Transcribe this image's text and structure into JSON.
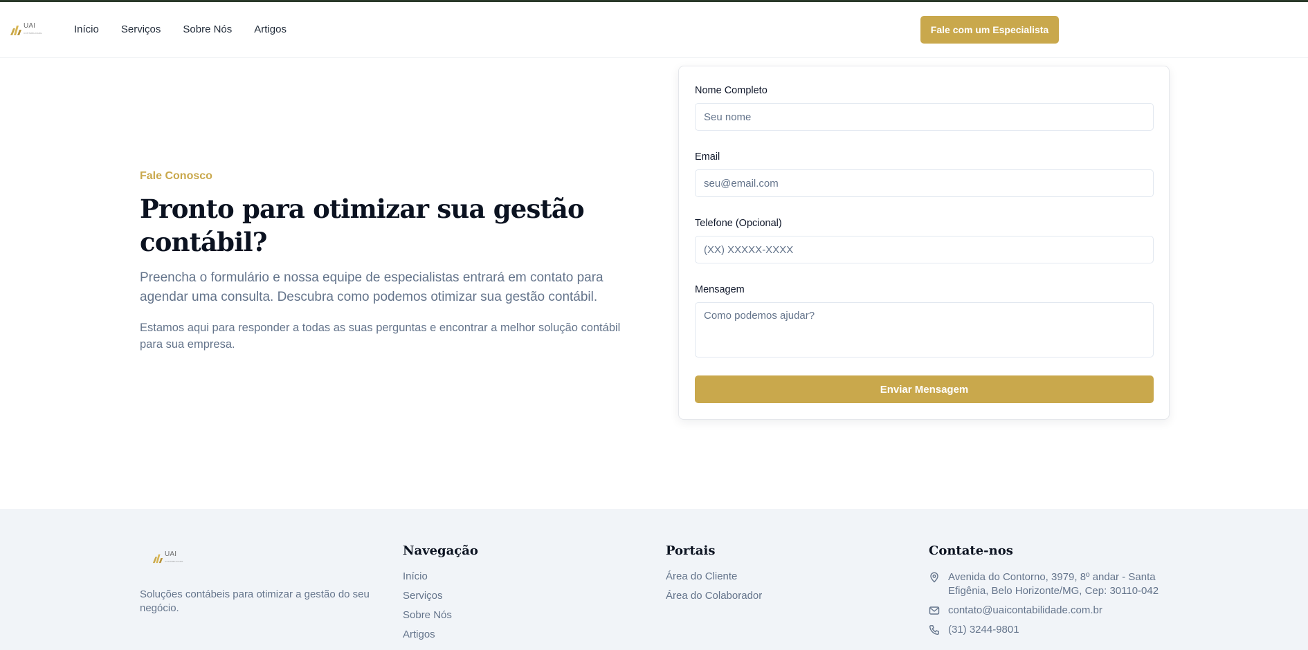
{
  "header": {
    "logo_text": "UAI",
    "logo_sub": "CONTABILIDADE",
    "nav": [
      "Início",
      "Serviços",
      "Sobre Nós",
      "Artigos"
    ],
    "cta_label": "Fale com um Especialista"
  },
  "hero": {
    "eyebrow": "Fale Conosco",
    "title": "Pronto para otimizar sua gestão contábil?",
    "lead": "Preencha o formulário e nossa equipe de especialistas entrará em contato para agendar uma consulta. Descubra como podemos otimizar sua gestão contábil.",
    "sub": "Estamos aqui para responder a todas as suas perguntas e encontrar a melhor solução contábil para sua empresa."
  },
  "form": {
    "name_label": "Nome Completo",
    "name_placeholder": "Seu nome",
    "email_label": "Email",
    "email_placeholder": "seu@email.com",
    "phone_label": "Telefone (Opcional)",
    "phone_placeholder": "(XX) XXXXX-XXXX",
    "message_label": "Mensagem",
    "message_placeholder": "Como podemos ajudar?",
    "submit_label": "Enviar Mensagem"
  },
  "footer": {
    "description": "Soluções contábeis para otimizar a gestão do seu negócio.",
    "nav_title": "Navegação",
    "nav_items": [
      "Início",
      "Serviços",
      "Sobre Nós",
      "Artigos"
    ],
    "portals_title": "Portais",
    "portals_items": [
      "Área do Cliente",
      "Área do Colaborador"
    ],
    "contact_title": "Contate-nos",
    "address": "Avenida do Contorno, 3979, 8º andar - Santa Efigênia, Belo Horizonte/MG, Cep: 30110-042",
    "email": "contato@uaicontabilidade.com.br",
    "phone": "(31) 3244-9801"
  },
  "colors": {
    "accent": "#c9a84c",
    "footer_bg": "#f1f4f8",
    "muted_text": "#64748b"
  }
}
